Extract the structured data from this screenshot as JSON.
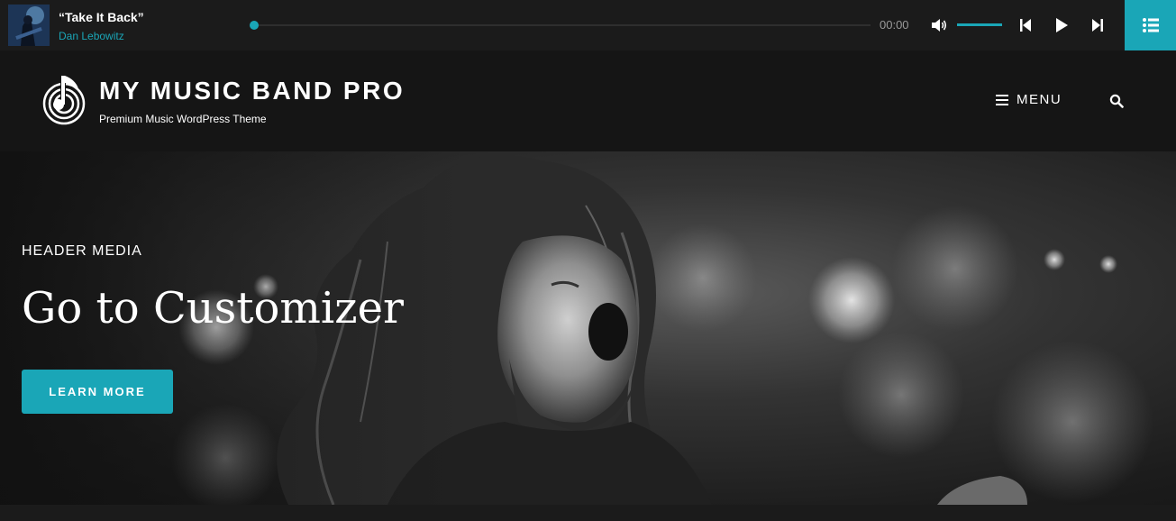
{
  "player": {
    "track_title": "“Take It Back”",
    "track_artist": "Dan Lebowitz",
    "time": "00:00",
    "progress": 0,
    "volume": 1.0,
    "accent_color": "#1aa6b7",
    "icons": {
      "album_art": "album-art-icon",
      "volume": "volume-icon",
      "prev": "skip-previous-icon",
      "play": "play-icon",
      "next": "skip-next-icon",
      "playlist": "playlist-icon"
    }
  },
  "header": {
    "site_title": "MY MUSIC BAND PRO",
    "tagline": "Premium Music WordPress Theme",
    "menu_label": "MENU",
    "icons": {
      "logo": "music-note-logo-icon",
      "menu": "hamburger-icon",
      "search": "search-icon"
    }
  },
  "hero": {
    "eyebrow": "HEADER MEDIA",
    "title": "Go to Customizer",
    "button_label": "LEARN MORE"
  }
}
